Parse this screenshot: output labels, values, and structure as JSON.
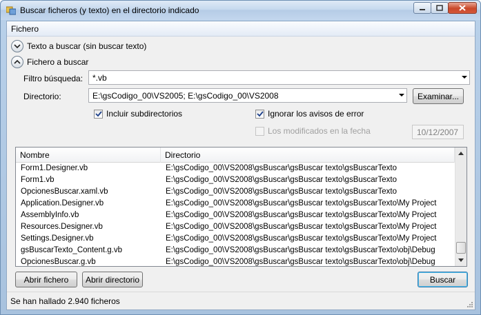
{
  "window": {
    "title": "Buscar ficheros (y texto) en el directorio indicado"
  },
  "menu": {
    "file": "Fichero"
  },
  "sections": {
    "text_search": "Texto a buscar (sin buscar texto)",
    "file_search": "Fichero a buscar"
  },
  "form": {
    "filter_label": "Filtro búsqueda:",
    "filter_value": "*.vb",
    "directory_label": "Directorio:",
    "directory_value": "E:\\gsCodigo_00\\VS2005; E:\\gsCodigo_00\\VS2008",
    "browse_button": "Examinar...",
    "include_subdirs": {
      "label": "Incluir subdirectorios",
      "checked": true
    },
    "ignore_errors": {
      "label": "Ignorar los avisos de error",
      "checked": true
    },
    "modified_on": {
      "label": "Los modificados en la fecha",
      "checked": false,
      "enabled": false
    },
    "date_value": "10/12/2007"
  },
  "results": {
    "columns": [
      "Nombre",
      "Directorio"
    ],
    "rows": [
      [
        "Form1.Designer.vb",
        "E:\\gsCodigo_00\\VS2008\\gsBuscar\\gsBuscar texto\\gsBuscarTexto"
      ],
      [
        "Form1.vb",
        "E:\\gsCodigo_00\\VS2008\\gsBuscar\\gsBuscar texto\\gsBuscarTexto"
      ],
      [
        "OpcionesBuscar.xaml.vb",
        "E:\\gsCodigo_00\\VS2008\\gsBuscar\\gsBuscar texto\\gsBuscarTexto"
      ],
      [
        "Application.Designer.vb",
        "E:\\gsCodigo_00\\VS2008\\gsBuscar\\gsBuscar texto\\gsBuscarTexto\\My Project"
      ],
      [
        "AssemblyInfo.vb",
        "E:\\gsCodigo_00\\VS2008\\gsBuscar\\gsBuscar texto\\gsBuscarTexto\\My Project"
      ],
      [
        "Resources.Designer.vb",
        "E:\\gsCodigo_00\\VS2008\\gsBuscar\\gsBuscar texto\\gsBuscarTexto\\My Project"
      ],
      [
        "Settings.Designer.vb",
        "E:\\gsCodigo_00\\VS2008\\gsBuscar\\gsBuscar texto\\gsBuscarTexto\\My Project"
      ],
      [
        "gsBuscarTexto_Content.g.vb",
        "E:\\gsCodigo_00\\VS2008\\gsBuscar\\gsBuscar texto\\gsBuscarTexto\\obj\\Debug"
      ],
      [
        "OpcionesBuscar.g.vb",
        "E:\\gsCodigo_00\\VS2008\\gsBuscar\\gsBuscar texto\\gsBuscarTexto\\obj\\Debug"
      ]
    ]
  },
  "buttons": {
    "open_file": "Abrir fichero",
    "open_dir": "Abrir directorio",
    "search": "Buscar"
  },
  "status": {
    "text": "Se han hallado 2.940 ficheros"
  }
}
